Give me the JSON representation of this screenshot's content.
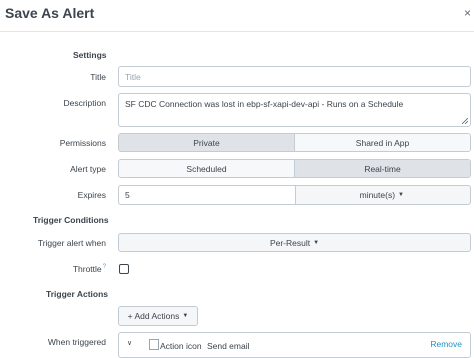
{
  "dialog": {
    "title": "Save As Alert",
    "close_label": "×"
  },
  "settings": {
    "heading": "Settings",
    "title_label": "Title",
    "title_placeholder": "Title",
    "title_value": "",
    "description_label": "Description",
    "description_value": "SF CDC Connection was lost in ebp-sf-xapi-dev-api - Runs on a Schedule",
    "permissions_label": "Permissions",
    "permissions_options": [
      "Private",
      "Shared in App"
    ],
    "permissions_selected": "Private",
    "alert_type_label": "Alert type",
    "alert_type_options": [
      "Scheduled",
      "Real-time"
    ],
    "alert_type_selected": "Real-time",
    "expires_label": "Expires",
    "expires_value": "5",
    "expires_unit": "minute(s)"
  },
  "trigger_conditions": {
    "heading": "Trigger Conditions",
    "trigger_when_label": "Trigger alert when",
    "trigger_when_value": "Per-Result",
    "throttle_label": "Throttle",
    "throttle_help": "?",
    "throttle_checked": false
  },
  "trigger_actions": {
    "heading": "Trigger Actions",
    "add_actions_label": "+ Add Actions",
    "when_triggered_label": "When triggered",
    "action_icon_alt": "Action icon",
    "action_name": "Send email",
    "remove_label": "Remove"
  }
}
